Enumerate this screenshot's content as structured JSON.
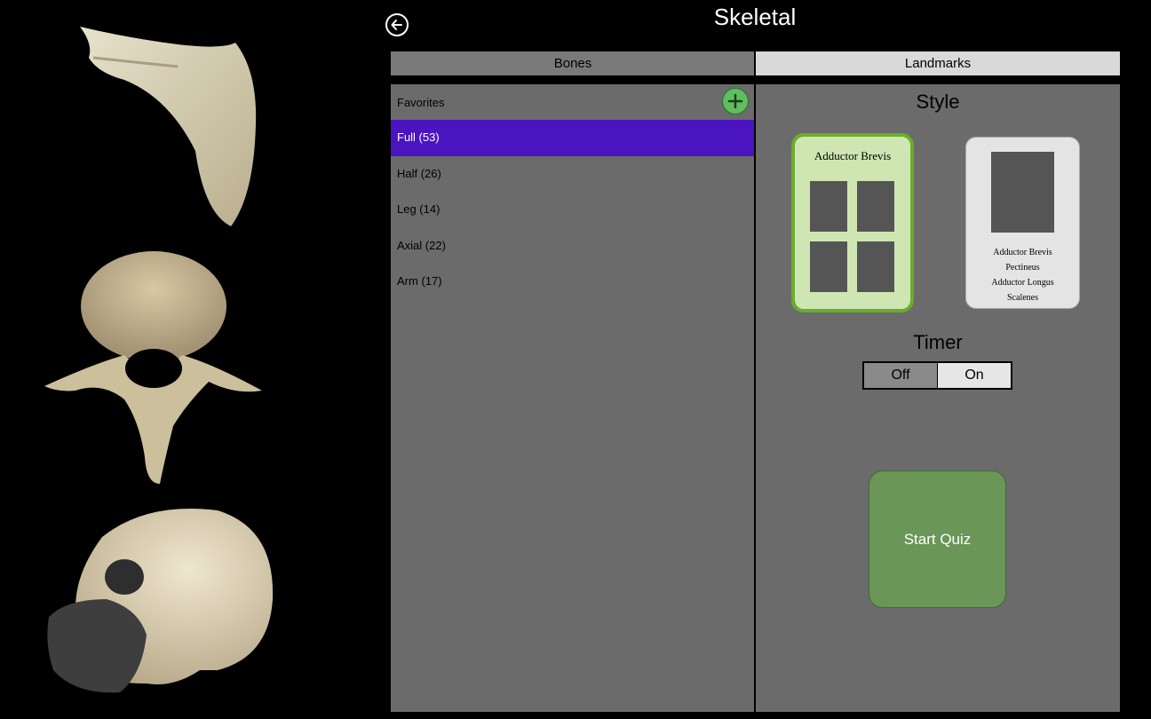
{
  "header": {
    "title": "Skeletal",
    "back_icon": "back-arrow-icon"
  },
  "tabs": [
    {
      "label": "Bones"
    },
    {
      "label": "Landmarks"
    }
  ],
  "bones_list": {
    "favorites_label": "Favorites",
    "add_icon": "plus-icon",
    "items": [
      {
        "label": "Full (53)",
        "selected": true
      },
      {
        "label": "Half (26)"
      },
      {
        "label": "Leg (14)"
      },
      {
        "label": "Axial (22)"
      },
      {
        "label": "Arm (17)"
      }
    ]
  },
  "settings": {
    "style_title": "Style",
    "style_card_a": {
      "name": "Adductor Brevis"
    },
    "style_card_b": {
      "lines": [
        "Adductor Brevis",
        "Pectineus",
        "Adductor Longus",
        "Scalenes"
      ]
    },
    "timer_title": "Timer",
    "timer_off": "Off",
    "timer_on": "On",
    "start_button": "Start Quiz"
  },
  "colors": {
    "selected_row": "#4a14c0",
    "start_button": "#6a9657",
    "style_card_border": "#6aad2a"
  }
}
